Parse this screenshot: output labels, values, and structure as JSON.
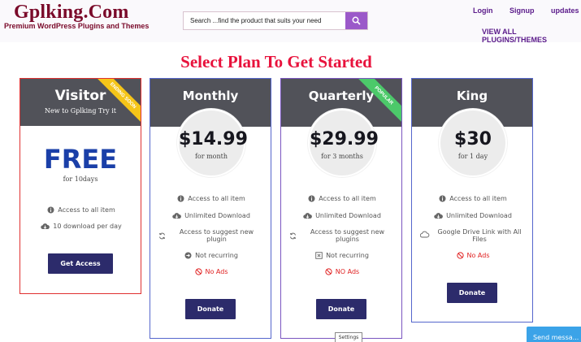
{
  "header": {
    "logo": "Gplking.Com",
    "tagline": "Premium WordPress Plugins and Themes",
    "search_placeholder": "Search ...find the product that suits your need",
    "nav": {
      "login": "Login",
      "signup": "Signup",
      "updates": "updates"
    },
    "view_all": "VIEW ALL PLUGINS/THEMES"
  },
  "heading": "Select Plan To Get Started",
  "plans": {
    "visitor": {
      "name": "Visitor",
      "subtitle": "New to Gplking Try it",
      "ribbon": "Ending Soon",
      "price": "FREE",
      "period": "for 10days",
      "features": [
        "Access to all item",
        "10 download per day"
      ],
      "button": "Get Access"
    },
    "monthly": {
      "name": "Monthly",
      "price": "$14.99",
      "period": "for month",
      "features": [
        "Access to all item",
        "Unlimited Download",
        "Access to suggest new plugin",
        "Not recurring",
        "No Ads"
      ],
      "button": "Donate"
    },
    "quarterly": {
      "name": "Quarterly",
      "ribbon": "Popular",
      "price": "$29.99",
      "period": "for 3 months",
      "features": [
        "Access to all item",
        "Unlimited Download",
        "Access to suggest new plugins",
        "Not recurring",
        "NO Ads"
      ],
      "button": "Donate"
    },
    "king": {
      "name": "King",
      "price": "$30",
      "period": "for 1 day",
      "features": [
        "Access to all item",
        "Unlimited Download",
        "Google Drive Link with All Files",
        "No Ads"
      ],
      "button": "Donate"
    }
  },
  "settings_tab": "Settings",
  "chat": "Send messa...",
  "colors": {
    "brand": "#7a0a2a",
    "heading": "#e8123c",
    "button": "#2c2b6b",
    "free": "#1a3fa8",
    "no_ads": "#e02020"
  }
}
